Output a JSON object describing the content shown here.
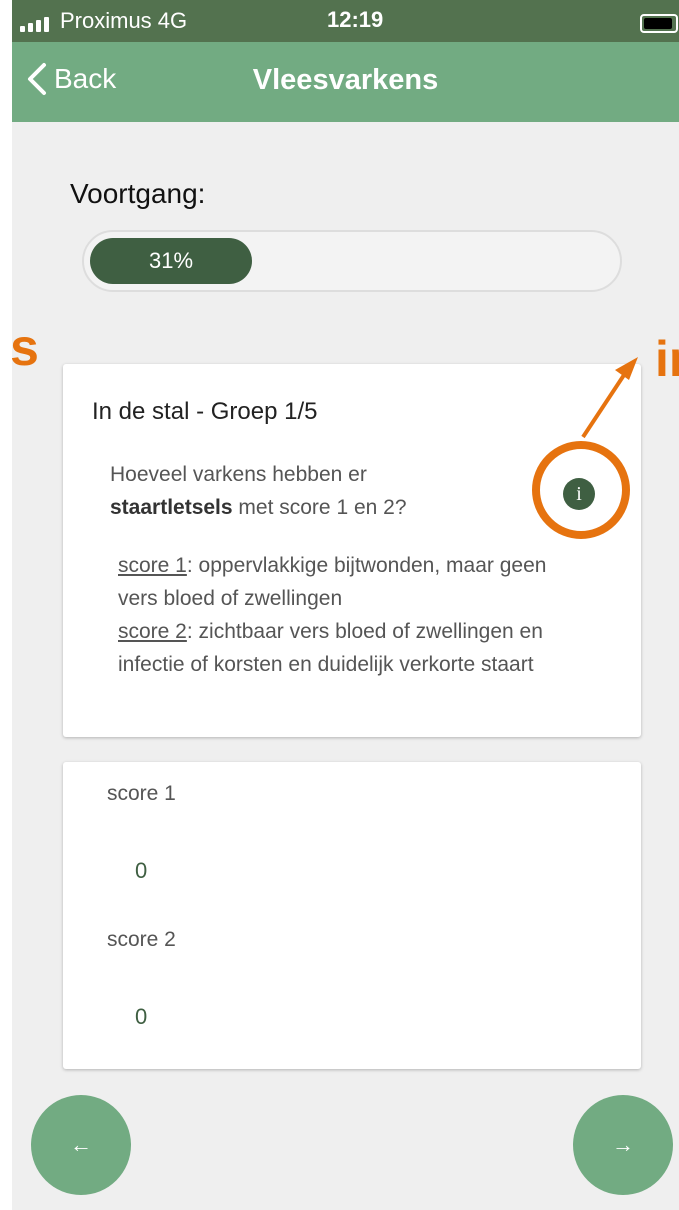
{
  "status_bar": {
    "carrier": "Proximus  4G",
    "time": "12:19"
  },
  "nav": {
    "back_label": "Back",
    "title": "Vleesvarkens"
  },
  "progress": {
    "label": "Voortgang:",
    "percent_text": "31%",
    "value": 0.31
  },
  "annotations": {
    "left_text": "s",
    "right_text": "in"
  },
  "question_card": {
    "group_title": "In de stal - Groep 1/5",
    "question_prefix": "Hoeveel varkens hebben er",
    "question_bold": "staartletsels",
    "question_suffix": " met score 1 en 2?",
    "info_glyph": "i",
    "score1_term": "score 1",
    "score1_desc": ": oppervlakkige bijtwonden, maar geen vers bloed of zwellingen",
    "score2_term": "score 2",
    "score2_desc": ": zichtbaar vers bloed of zwellingen en infectie of korsten en duidelijk verkorte staart"
  },
  "inputs": [
    {
      "label": "score 1",
      "value": "0"
    },
    {
      "label": "score 2",
      "value": "0"
    }
  ],
  "bottom_nav": {
    "prev_glyph": "←",
    "next_glyph": "→"
  },
  "colors": {
    "nav_green": "#72ab82",
    "dark_green": "#3f5f42",
    "annotation_orange": "#e6730f",
    "background": "#efefef"
  },
  "icons": [
    "signal-icon",
    "battery-icon",
    "chevron-left-icon",
    "info-icon",
    "arrow-left-icon",
    "arrow-right-icon"
  ]
}
